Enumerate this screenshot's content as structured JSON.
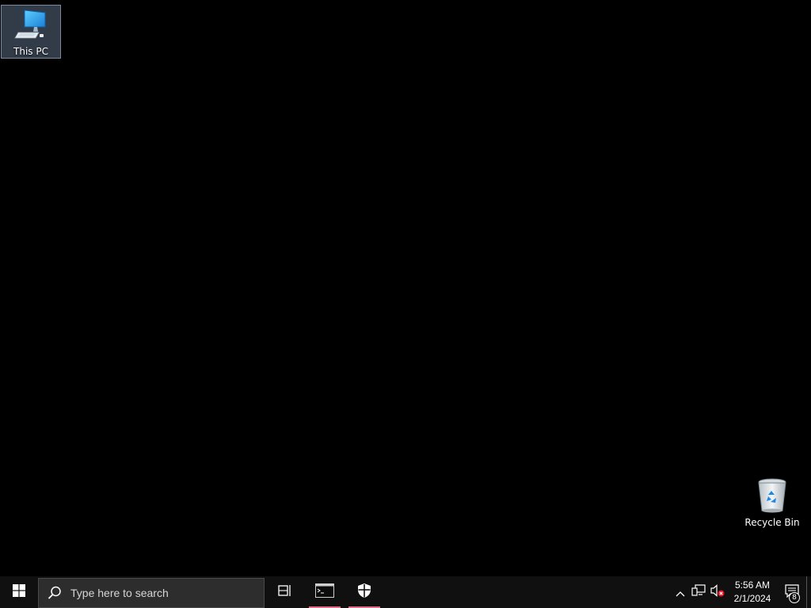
{
  "desktop": {
    "icons": [
      {
        "label": "This PC",
        "icon": "computer-icon",
        "selected": true
      },
      {
        "label": "Recycle Bin",
        "icon": "recycle-bin-icon",
        "selected": false
      }
    ]
  },
  "taskbar": {
    "start_icon": "windows-logo-icon",
    "search": {
      "placeholder": "Type here to search",
      "icon": "search-icon"
    },
    "task_view_icon": "task-view-icon",
    "apps": [
      {
        "icon": "command-prompt-icon",
        "running": true
      },
      {
        "icon": "windows-security-icon",
        "running": true
      }
    ],
    "tray": {
      "chevron_icon": "chevron-up-icon",
      "network_icon": "network-icon",
      "volume_icon": "volume-muted-icon",
      "time": "5:56 AM",
      "date": "2/1/2024",
      "notification_icon": "action-center-icon",
      "notification_count": "8"
    }
  },
  "colors": {
    "desktop_background": "#000000",
    "taskbar_background": "#101010",
    "running_indicator": "#e06c8a",
    "selection": "#7a8aa0"
  }
}
